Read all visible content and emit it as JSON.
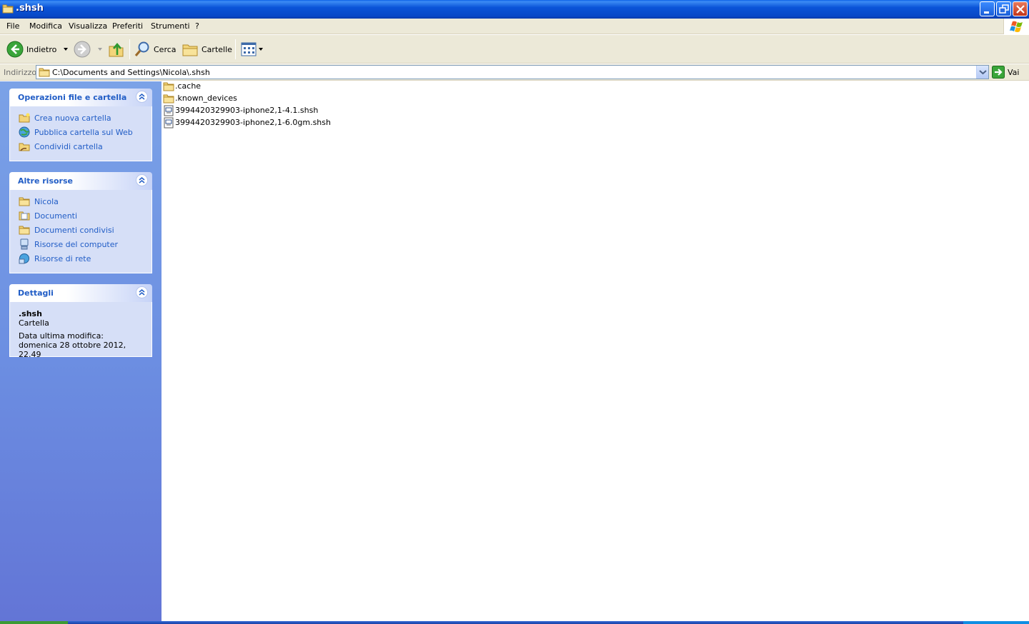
{
  "window": {
    "title": ".shsh",
    "controls": [
      "minimize",
      "restore",
      "close"
    ]
  },
  "menu": [
    "File",
    "Modifica",
    "Visualizza",
    "Preferiti",
    "Strumenti",
    "?"
  ],
  "toolbar": {
    "back_label": "Indietro",
    "search_label": "Cerca",
    "folders_label": "Cartelle"
  },
  "address": {
    "label": "Indirizzo",
    "value": "C:\\Documents and Settings\\Nicola\\.shsh",
    "go_label": "Vai"
  },
  "taskpane": {
    "file_tasks": {
      "title": "Operazioni file e cartella",
      "items": [
        {
          "label": "Crea nuova cartella",
          "icon": "new-folder-icon"
        },
        {
          "label": "Pubblica cartella sul Web",
          "icon": "publish-web-icon"
        },
        {
          "label": "Condividi cartella",
          "icon": "share-folder-icon"
        }
      ]
    },
    "other_places": {
      "title": "Altre risorse",
      "items": [
        {
          "label": "Nicola",
          "icon": "folder-icon"
        },
        {
          "label": "Documenti",
          "icon": "documents-icon"
        },
        {
          "label": "Documenti condivisi",
          "icon": "folder-icon"
        },
        {
          "label": "Risorse del computer",
          "icon": "computer-icon"
        },
        {
          "label": "Risorse di rete",
          "icon": "network-icon"
        }
      ]
    },
    "details": {
      "title": "Dettagli",
      "name": ".shsh",
      "type": "Cartella",
      "modified": "Data ultima modifica: domenica 28 ottobre 2012, 22.49"
    }
  },
  "files": [
    {
      "name": ".cache",
      "kind": "folder"
    },
    {
      "name": ".known_devices",
      "kind": "folder"
    },
    {
      "name": "3994420329903-iphone2,1-4.1.shsh",
      "kind": "file"
    },
    {
      "name": "3994420329903-iphone2,1-6.0gm.shsh",
      "kind": "file"
    }
  ],
  "colors": {
    "titlebar": "#0a54d8",
    "link": "#215dc6",
    "chrome": "#ece9d8",
    "taskpane": "#6c8fe2"
  }
}
